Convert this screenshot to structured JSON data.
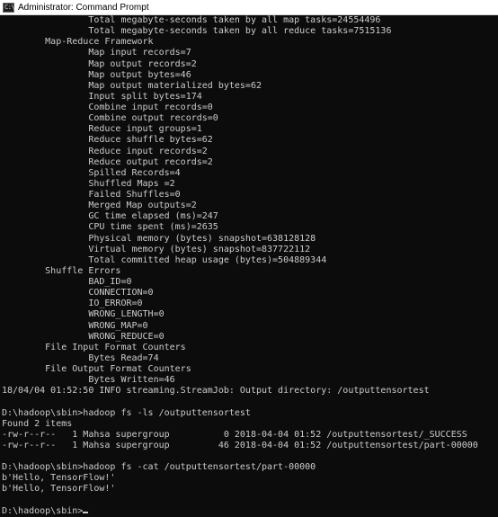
{
  "window": {
    "title": "Administrator: Command Prompt",
    "icon": "cmd-prompt-icon",
    "icon_glyph": "C:\\"
  },
  "colors": {
    "console_background": "#0c0c0c",
    "console_text": "#cccccc",
    "titlebar_background": "#ffffff"
  },
  "console": {
    "lines": [
      "                Total megabyte-seconds taken by all map tasks=24554496",
      "                Total megabyte-seconds taken by all reduce tasks=7515136",
      "        Map-Reduce Framework",
      "                Map input records=7",
      "                Map output records=2",
      "                Map output bytes=46",
      "                Map output materialized bytes=62",
      "                Input split bytes=174",
      "                Combine input records=0",
      "                Combine output records=0",
      "                Reduce input groups=1",
      "                Reduce shuffle bytes=62",
      "                Reduce input records=2",
      "                Reduce output records=2",
      "                Spilled Records=4",
      "                Shuffled Maps =2",
      "                Failed Shuffles=0",
      "                Merged Map outputs=2",
      "                GC time elapsed (ms)=247",
      "                CPU time spent (ms)=2635",
      "                Physical memory (bytes) snapshot=638128128",
      "                Virtual memory (bytes) snapshot=837722112",
      "                Total committed heap usage (bytes)=504889344",
      "        Shuffle Errors",
      "                BAD_ID=0",
      "                CONNECTION=0",
      "                IO_ERROR=0",
      "                WRONG_LENGTH=0",
      "                WRONG_MAP=0",
      "                WRONG_REDUCE=0",
      "        File Input Format Counters",
      "                Bytes Read=74",
      "        File Output Format Counters",
      "                Bytes Written=46",
      "18/04/04 01:52:50 INFO streaming.StreamJob: Output directory: /outputtensortest",
      "",
      "D:\\hadoop\\sbin>hadoop fs -ls /outputtensortest",
      "Found 2 items",
      "-rw-r--r--   1 Mahsa supergroup          0 2018-04-04 01:52 /outputtensortest/_SUCCESS",
      "-rw-r--r--   1 Mahsa supergroup         46 2018-04-04 01:52 /outputtensortest/part-00000",
      "",
      "D:\\hadoop\\sbin>hadoop fs -cat /outputtensortest/part-00000",
      "b'Hello, TensorFlow!'",
      "b'Hello, TensorFlow!'",
      "",
      "D:\\hadoop\\sbin>"
    ]
  }
}
